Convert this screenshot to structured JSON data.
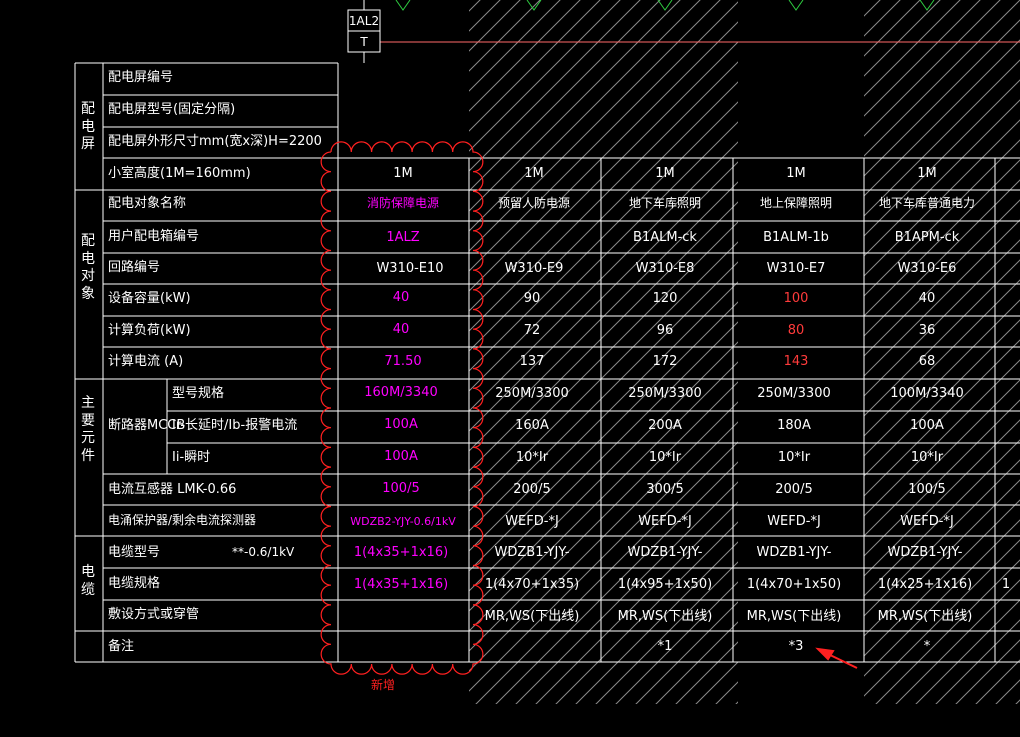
{
  "colors": {
    "background": "#000000",
    "grid": "#ffffff",
    "magenta": "#ff00ff",
    "red": "#ff3b3b",
    "hatch": "#8a8a8a",
    "cloud": "#ff2020",
    "bus": "#ff6a6a"
  },
  "top_symbol": {
    "upper": "1AL2",
    "lower": "T"
  },
  "groups": {
    "pdp": "配\n电\n屏",
    "target": "配\n电\n对\n象",
    "main": "主\n要\n元\n件",
    "cable": "电\n缆"
  },
  "rows": {
    "panel_no": "配电屏编号",
    "panel_model": "配电屏型号(固定分隔)",
    "panel_size": "配电屏外形尺寸mm(宽x深)H=2200",
    "room_width": "小室高度(1M=160mm)",
    "target_name": "配电对象名称",
    "user_box": "用户配电箱编号",
    "circuit_no": "回路编号",
    "capacity": "设备容量(kW)",
    "calc_load": "计算负荷(kW)",
    "calc_current": "计算电流 (A)",
    "breaker": "断路器MCCB",
    "model_spec": "型号规格",
    "ir": "Ir-长延时/Ib-报警电流",
    "ii": "Ii-瞬时",
    "ct": "电流互感器  LMK-0.66",
    "sensor": "电涌保护器/剩余电流探测器",
    "cable_model": "电缆型号",
    "cable_voltage": "**-0.6/1kV",
    "cable_spec": "电缆规格",
    "laying": "敷设方式或穿管",
    "remark": "备注"
  },
  "columns": [
    {
      "width": "1M",
      "target": "消防保障电源",
      "user_box": "1ALZ",
      "circuit": "W310-E10",
      "capacity": "40",
      "load": "40",
      "current": "71.50",
      "model": "160M/3340",
      "ir": "100A",
      "ii": "100A",
      "ct": "100/5",
      "sensor": "WDZB2-YJY-0.6/1kV",
      "cable_model": "1(4x35+1x16)",
      "cable_spec": "1(4x35+1x16)",
      "laying": "",
      "remark": ""
    },
    {
      "width": "1M",
      "target": "预留人防电源",
      "user_box": "",
      "circuit": "W310-E9",
      "capacity": "90",
      "load": "72",
      "current": "137",
      "model": "250M/3300",
      "ir": "160A",
      "ii": "10*Ir",
      "ct": "200/5",
      "sensor": "WEFD-*J",
      "cable_model": "WDZB1-YJY-",
      "cable_spec": "1(4x70+1x35)",
      "laying": "MR,WS(下出线)",
      "remark": ""
    },
    {
      "width": "1M",
      "target": "地下车库照明",
      "user_box": "B1ALM-ck",
      "circuit": "W310-E8",
      "capacity": "120",
      "load": "96",
      "current": "172",
      "model": "250M/3300",
      "ir": "200A",
      "ii": "10*Ir",
      "ct": "300/5",
      "sensor": "WEFD-*J",
      "cable_model": "WDZB1-YJY-",
      "cable_spec": "1(4x95+1x50)",
      "laying": "MR,WS(下出线)",
      "remark": "*1"
    },
    {
      "width": "1M",
      "target": "地上保障照明",
      "user_box": "B1ALM-1b",
      "circuit": "W310-E7",
      "capacity": "100",
      "load": "80",
      "current": "143",
      "model": "250M/3300",
      "ir": "180A",
      "ii": "10*Ir",
      "ct": "200/5",
      "sensor": "WEFD-*J",
      "cable_model": "WDZB1-YJY-",
      "cable_spec": "1(4x70+1x50)",
      "laying": "MR,WS(下出线)",
      "remark": "*3"
    },
    {
      "width": "1M",
      "target": "地下车库普通电力",
      "user_box": "B1APM-ck",
      "circuit": "W310-E6",
      "capacity": "40",
      "load": "36",
      "current": "68",
      "model": "100M/3340",
      "ir": "100A",
      "ii": "10*Ir",
      "ct": "100/5",
      "sensor": "WEFD-*J",
      "cable_model": "WDZB1-YJY-",
      "cable_spec": "1(4x25+1x16)",
      "laying": "MR,WS(下出线)",
      "remark": "*"
    }
  ],
  "partial_col": {
    "cable_spec": "1"
  },
  "cloud_note": "新增"
}
